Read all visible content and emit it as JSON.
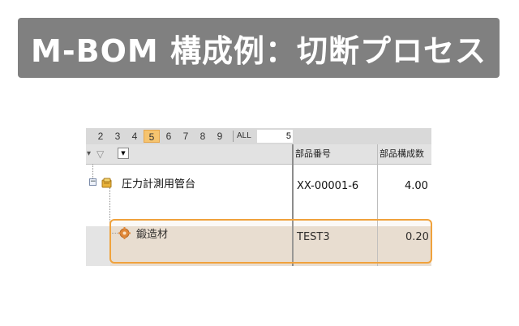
{
  "banner": {
    "title": "M-BOM 構成例：切断プロセス"
  },
  "level_bar": {
    "levels": [
      "2",
      "3",
      "4",
      "5",
      "6",
      "7",
      "8",
      "9"
    ],
    "active_level": "5",
    "all_label": "ALL",
    "level_input_value": "5"
  },
  "columns": {
    "part_number": "部品番号",
    "quantity": "部品構成数"
  },
  "rows": [
    {
      "name": "圧力計測用管台",
      "part_number": "XX-00001-6",
      "quantity": "4.00",
      "icon": "assembly-icon"
    },
    {
      "name": "鍛造材",
      "part_number": "TEST3",
      "quantity": "0.20",
      "icon": "gear-icon"
    }
  ],
  "colors": {
    "banner_bg": "#808080",
    "active_level": "#f6c46f",
    "highlight_border": "#f0a23c",
    "selected_row_bg": "#e9ded2"
  }
}
